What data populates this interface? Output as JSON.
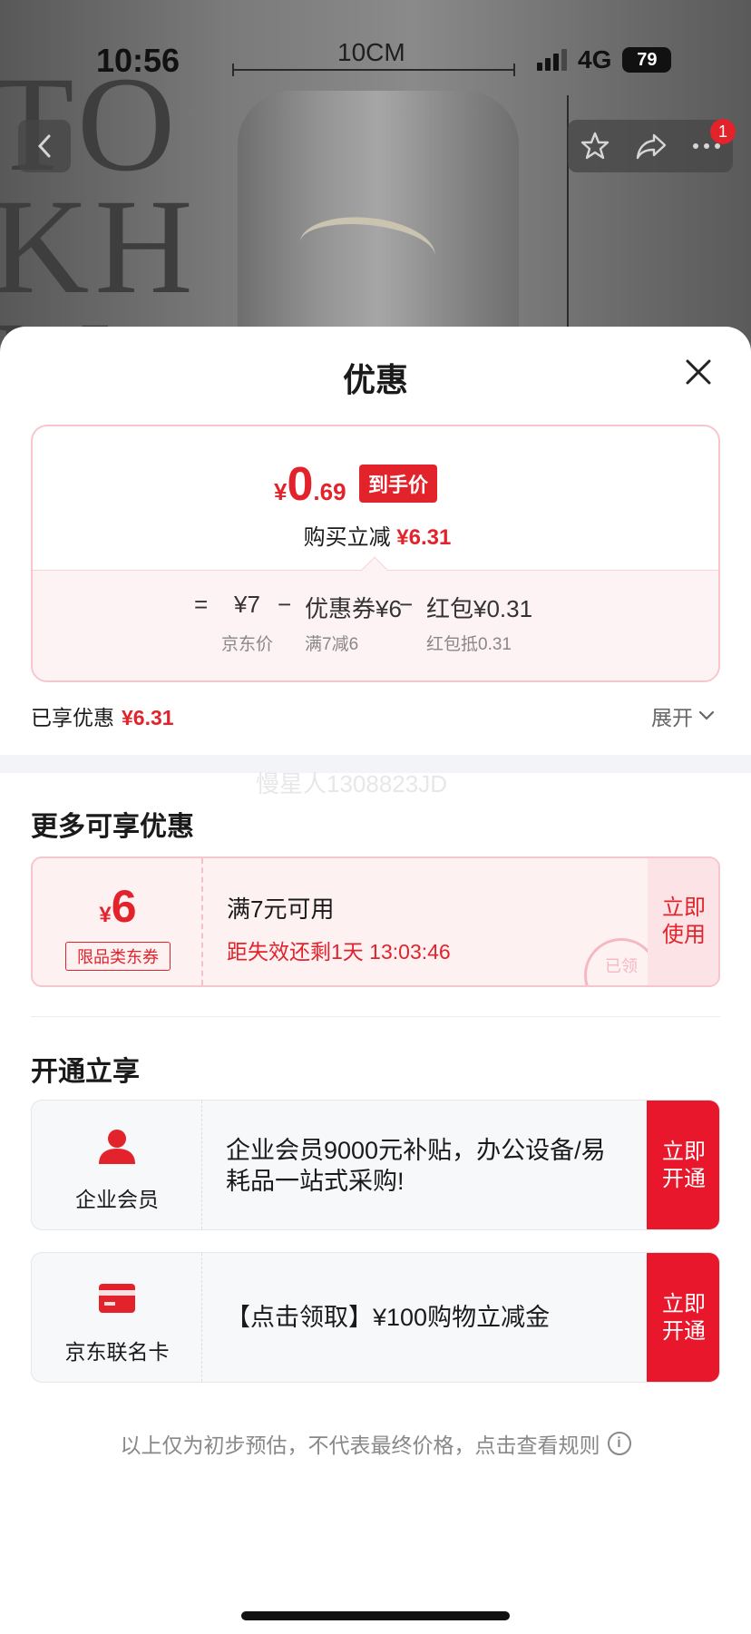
{
  "status_bar": {
    "time": "10:56",
    "network": "4G",
    "battery": "79"
  },
  "background": {
    "dimension_label": "10CM",
    "letters": "TO\nKH\nM"
  },
  "top_nav": {
    "cart_badge": "1"
  },
  "sheet": {
    "title": "优惠",
    "price_card": {
      "currency": "¥",
      "final_int": "0",
      "final_dec": ".69",
      "final_tag": "到手价",
      "reduce_prefix": "购买立减",
      "reduce_amount": "¥6.31",
      "equals": "=",
      "minus": "−",
      "items": [
        {
          "value": "¥7",
          "label": "京东价"
        },
        {
          "value": "优惠券¥6",
          "label": "满7减6"
        },
        {
          "value": "红包¥0.31",
          "label": "红包抵0.31"
        }
      ]
    },
    "enjoyed": {
      "label": "已享优惠",
      "amount": "¥6.31",
      "expand_label": "展开"
    },
    "watermark": "慢星人1308823JD",
    "more_section": {
      "title": "更多可享优惠",
      "coupon": {
        "currency": "¥",
        "amount": "6",
        "tag": "限品类东券",
        "condition": "满7元可用",
        "expire": "距失效还剩1天 13:03:46",
        "stamp": "已领",
        "action": "立即\n使用"
      }
    },
    "open_section": {
      "title": "开通立享",
      "offers": [
        {
          "icon": "person-icon",
          "name": "企业会员",
          "text": "企业会员9000元补贴，办公设备/易耗品一站式采购!",
          "action": "立即\n开通"
        },
        {
          "icon": "credit-card-icon",
          "name": "京东联名卡",
          "text": "【点击领取】¥100购物立减金",
          "action": "立即\n开通"
        }
      ]
    },
    "footnote": "以上仅为初步预估，不代表最终价格，点击查看规则"
  },
  "colors": {
    "accent": "#e3232c",
    "button_red": "#e8172b",
    "pink_border": "#f7c6cd",
    "pink_bg": "#fdf1f2"
  }
}
